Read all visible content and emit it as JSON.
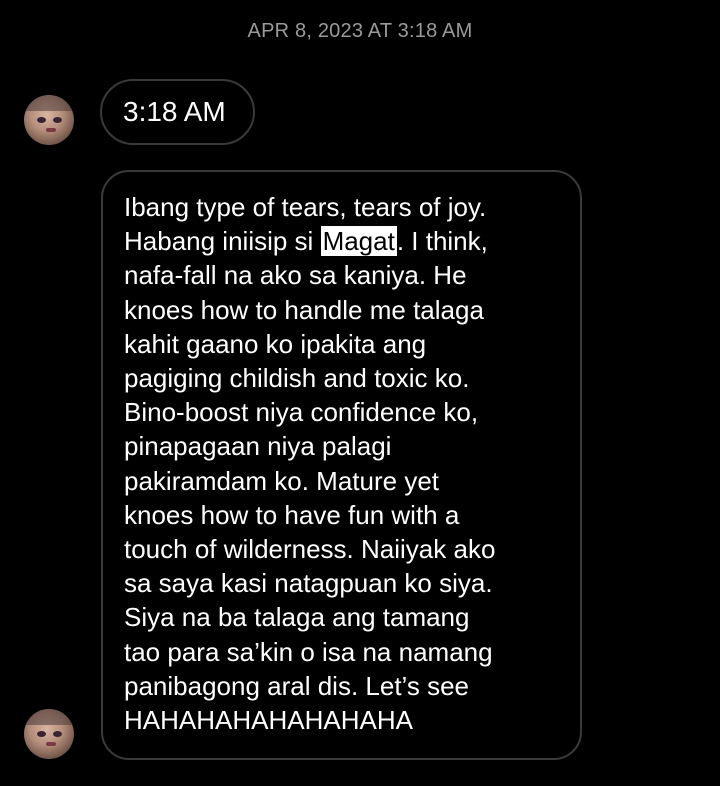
{
  "header": {
    "timestamp": "APR 8, 2023 AT 3:18 AM"
  },
  "messages": {
    "time_message": "3:18 AM",
    "long_message": {
      "lines": [
        {
          "text": "Ibang type of tears, tears of joy."
        },
        {
          "pre": "Habang iniisip si ",
          "highlight": "Magat",
          "post": ". I think,"
        },
        {
          "text": "nafa-fall na ako sa kaniya. He"
        },
        {
          "text": "knoes how to handle me talaga"
        },
        {
          "text": "kahit gaano ko ipakita ang"
        },
        {
          "text": "pagiging childish and toxic ko."
        },
        {
          "text": "Bino-boost niya confidence ko,"
        },
        {
          "text": "pinapagaan niya palagi"
        },
        {
          "text": "pakiramdam ko. Mature yet"
        },
        {
          "text": "knoes how to have fun with a"
        },
        {
          "text": "touch of wilderness. Naiiyak ako"
        },
        {
          "text": "sa saya kasi natagpuan ko siya."
        },
        {
          "text": "Siya na ba talaga ang tamang"
        },
        {
          "text": "tao para sa’kin o isa na namang"
        },
        {
          "text": "panibagong aral dis. Let’s see"
        },
        {
          "text": "HAHAHAHAHAHAHAHA"
        }
      ]
    }
  },
  "colors": {
    "background": "#000000",
    "bubble_border": "#3a3a3c",
    "timestamp_text": "#9a9a9a",
    "highlight_bg": "#ffffff"
  }
}
